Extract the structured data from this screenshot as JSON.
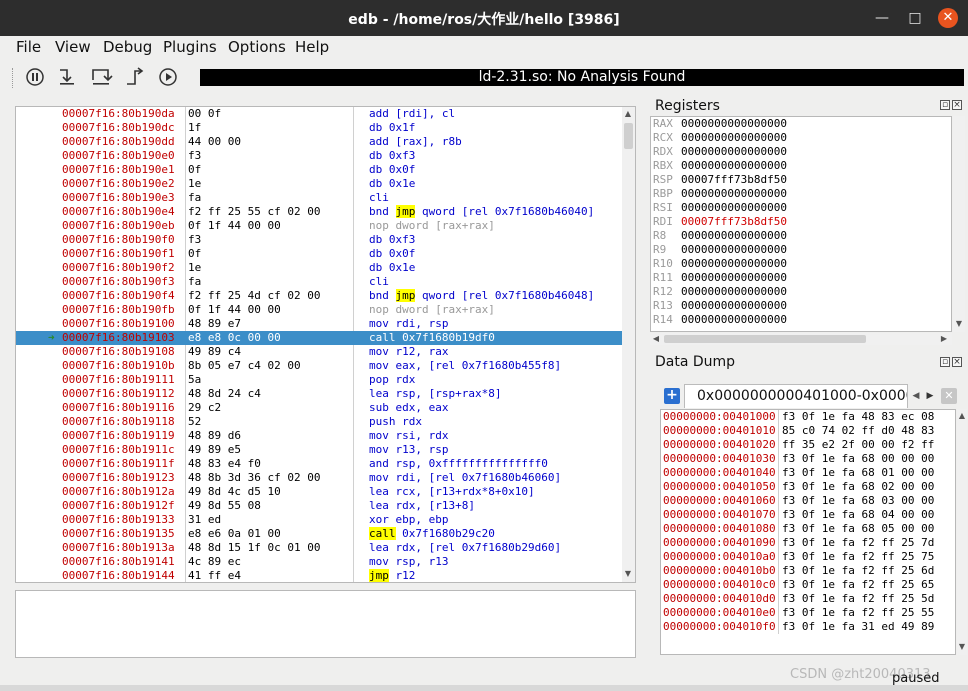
{
  "window": {
    "title": "edb - /home/ros/大作业/hello [3986]",
    "min_glyph": "—",
    "max_glyph": "□",
    "close_glyph": "✕"
  },
  "menu": [
    "File",
    "View",
    "Debug",
    "Plugins",
    "Options",
    "Help"
  ],
  "toolbar": {
    "analysis_status": "ld-2.31.so: No Analysis Found",
    "buttons": [
      "pause-icon",
      "step-into-icon",
      "step-over-icon",
      "step-out-icon",
      "run-icon"
    ]
  },
  "disassembly": {
    "rows": [
      {
        "addr": "00007f16:80b190da",
        "bytes": "00 0f",
        "mn": "add",
        "ops": "[rdi], cl"
      },
      {
        "addr": "00007f16:80b190dc",
        "bytes": "1f",
        "mn": "db",
        "ops": "0x1f"
      },
      {
        "addr": "00007f16:80b190dd",
        "bytes": "44 00 00",
        "mn": "add",
        "ops": "[rax], r8b"
      },
      {
        "addr": "00007f16:80b190e0",
        "bytes": "f3",
        "mn": "db",
        "ops": "0xf3"
      },
      {
        "addr": "00007f16:80b190e1",
        "bytes": "0f",
        "mn": "db",
        "ops": "0x0f"
      },
      {
        "addr": "00007f16:80b190e2",
        "bytes": "1e",
        "mn": "db",
        "ops": "0x1e"
      },
      {
        "addr": "00007f16:80b190e3",
        "bytes": "fa",
        "mn": "cli",
        "ops": ""
      },
      {
        "addr": "00007f16:80b190e4",
        "bytes": "f2 ff 25 55 cf 02 00",
        "mn": "bnd",
        "hl": "jmp",
        "ops": "qword [rel 0x7f1680b46040]"
      },
      {
        "addr": "00007f16:80b190eb",
        "bytes": "0f 1f 44 00 00",
        "mn": "nop",
        "ops": "dword [rax+rax]",
        "nop": true
      },
      {
        "addr": "00007f16:80b190f0",
        "bytes": "f3",
        "mn": "db",
        "ops": "0xf3"
      },
      {
        "addr": "00007f16:80b190f1",
        "bytes": "0f",
        "mn": "db",
        "ops": "0x0f"
      },
      {
        "addr": "00007f16:80b190f2",
        "bytes": "1e",
        "mn": "db",
        "ops": "0x1e"
      },
      {
        "addr": "00007f16:80b190f3",
        "bytes": "fa",
        "mn": "cli",
        "ops": ""
      },
      {
        "addr": "00007f16:80b190f4",
        "bytes": "f2 ff 25 4d cf 02 00",
        "mn": "bnd",
        "hl": "jmp",
        "ops": "qword [rel 0x7f1680b46048]"
      },
      {
        "addr": "00007f16:80b190fb",
        "bytes": "0f 1f 44 00 00",
        "mn": "nop",
        "ops": "dword [rax+rax]",
        "nop": true
      },
      {
        "addr": "00007f16:80b19100",
        "bytes": "48 89 e7",
        "mn": "mov",
        "ops": "rdi, rsp"
      },
      {
        "addr": "00007f16:80b19103",
        "bytes": "e8 e8 0c 00 00",
        "mn": "call",
        "ops": "0x7f1680b19df0",
        "current": true
      },
      {
        "addr": "00007f16:80b19108",
        "bytes": "49 89 c4",
        "mn": "mov",
        "ops": "r12, rax"
      },
      {
        "addr": "00007f16:80b1910b",
        "bytes": "8b 05 e7 c4 02 00",
        "mn": "mov",
        "ops": "eax, [rel 0x7f1680b455f8]"
      },
      {
        "addr": "00007f16:80b19111",
        "bytes": "5a",
        "mn": "pop",
        "ops": "rdx"
      },
      {
        "addr": "00007f16:80b19112",
        "bytes": "48 8d 24 c4",
        "mn": "lea",
        "ops": "rsp, [rsp+rax*8]"
      },
      {
        "addr": "00007f16:80b19116",
        "bytes": "29 c2",
        "mn": "sub",
        "ops": "edx, eax"
      },
      {
        "addr": "00007f16:80b19118",
        "bytes": "52",
        "mn": "push",
        "ops": "rdx"
      },
      {
        "addr": "00007f16:80b19119",
        "bytes": "48 89 d6",
        "mn": "mov",
        "ops": "rsi, rdx"
      },
      {
        "addr": "00007f16:80b1911c",
        "bytes": "49 89 e5",
        "mn": "mov",
        "ops": "r13, rsp"
      },
      {
        "addr": "00007f16:80b1911f",
        "bytes": "48 83 e4 f0",
        "mn": "and",
        "ops": "rsp, 0xfffffffffffffff0"
      },
      {
        "addr": "00007f16:80b19123",
        "bytes": "48 8b 3d 36 cf 02 00",
        "mn": "mov",
        "ops": "rdi, [rel 0x7f1680b46060]"
      },
      {
        "addr": "00007f16:80b1912a",
        "bytes": "49 8d 4c d5 10",
        "mn": "lea",
        "ops": "rcx, [r13+rdx*8+0x10]"
      },
      {
        "addr": "00007f16:80b1912f",
        "bytes": "49 8d 55 08",
        "mn": "lea",
        "ops": "rdx, [r13+8]"
      },
      {
        "addr": "00007f16:80b19133",
        "bytes": "31 ed",
        "mn": "xor",
        "ops": "ebp, ebp"
      },
      {
        "addr": "00007f16:80b19135",
        "bytes": "e8 e6 0a 01 00",
        "mn": "",
        "hl": "call",
        "ops": "0x7f1680b29c20"
      },
      {
        "addr": "00007f16:80b1913a",
        "bytes": "48 8d 15 1f 0c 01 00",
        "mn": "lea",
        "ops": "rdx, [rel 0x7f1680b29d60]"
      },
      {
        "addr": "00007f16:80b19141",
        "bytes": "4c 89 ec",
        "mn": "mov",
        "ops": "rsp, r13"
      },
      {
        "addr": "00007f16:80b19144",
        "bytes": "41 ff e4",
        "mn": "",
        "hl": "jmp",
        "ops": "r12"
      }
    ]
  },
  "registers": {
    "title": "Registers",
    "rows": [
      {
        "name": "RAX",
        "value": "0000000000000000"
      },
      {
        "name": "RCX",
        "value": "0000000000000000"
      },
      {
        "name": "RDX",
        "value": "0000000000000000"
      },
      {
        "name": "RBX",
        "value": "0000000000000000"
      },
      {
        "name": "RSP",
        "value": "00007fff73b8df50"
      },
      {
        "name": "RBP",
        "value": "0000000000000000"
      },
      {
        "name": "RSI",
        "value": "0000000000000000"
      },
      {
        "name": "RDI",
        "value": "00007fff73b8df50",
        "changed": true
      },
      {
        "name": "R8",
        "value": "0000000000000000"
      },
      {
        "name": "R9",
        "value": "0000000000000000"
      },
      {
        "name": "R10",
        "value": "0000000000000000"
      },
      {
        "name": "R11",
        "value": "0000000000000000"
      },
      {
        "name": "R12",
        "value": "0000000000000000"
      },
      {
        "name": "R13",
        "value": "0000000000000000"
      },
      {
        "name": "R14",
        "value": "0000000000000000"
      }
    ]
  },
  "data_dump": {
    "title": "Data Dump",
    "tab_label": "0x0000000000401000-0x0000",
    "rows": [
      {
        "addr": "00000000:00401000",
        "hex": "f3 0f 1e fa 48 83 ec 08"
      },
      {
        "addr": "00000000:00401010",
        "hex": "85 c0 74 02 ff d0 48 83"
      },
      {
        "addr": "00000000:00401020",
        "hex": "ff 35 e2 2f 00 00 f2 ff"
      },
      {
        "addr": "00000000:00401030",
        "hex": "f3 0f 1e fa 68 00 00 00"
      },
      {
        "addr": "00000000:00401040",
        "hex": "f3 0f 1e fa 68 01 00 00"
      },
      {
        "addr": "00000000:00401050",
        "hex": "f3 0f 1e fa 68 02 00 00"
      },
      {
        "addr": "00000000:00401060",
        "hex": "f3 0f 1e fa 68 03 00 00"
      },
      {
        "addr": "00000000:00401070",
        "hex": "f3 0f 1e fa 68 04 00 00"
      },
      {
        "addr": "00000000:00401080",
        "hex": "f3 0f 1e fa 68 05 00 00"
      },
      {
        "addr": "00000000:00401090",
        "hex": "f3 0f 1e fa f2 ff 25 7d"
      },
      {
        "addr": "00000000:004010a0",
        "hex": "f3 0f 1e fa f2 ff 25 75"
      },
      {
        "addr": "00000000:004010b0",
        "hex": "f3 0f 1e fa f2 ff 25 6d"
      },
      {
        "addr": "00000000:004010c0",
        "hex": "f3 0f 1e fa f2 ff 25 65"
      },
      {
        "addr": "00000000:004010d0",
        "hex": "f3 0f 1e fa f2 ff 25 5d"
      },
      {
        "addr": "00000000:004010e0",
        "hex": "f3 0f 1e fa f2 ff 25 55"
      },
      {
        "addr": "00000000:004010f0",
        "hex": "f3 0f 1e fa 31 ed 49 89"
      }
    ]
  },
  "status": "paused",
  "watermark": "CSDN @zht20040313"
}
